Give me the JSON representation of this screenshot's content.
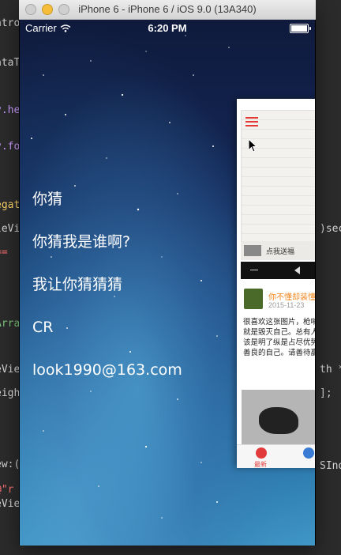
{
  "window": {
    "title": "iPhone 6 - iPhone 6 / iOS 9.0 (13A340)"
  },
  "status_bar": {
    "carrier": "Carrier",
    "time": "6:20 PM"
  },
  "menu": {
    "items": [
      {
        "label": "你猜"
      },
      {
        "label": "你猜我是谁啊?"
      },
      {
        "label": "我让你猜猜猜"
      },
      {
        "label": "CR"
      },
      {
        "label": "look1990@163.com"
      }
    ]
  },
  "preview": {
    "strip_text": "点我送福",
    "post_author": "你不懂却装懂",
    "post_date": "2015-11-23",
    "post_text": "很喜欢这张图片，枪哨声就是毁灭自己。总有人说该是明了纵是占尽优势做善良的自己。请善待赢了!",
    "tab_label": "最新"
  },
  "colors": {
    "accent_red": "#e53935",
    "author_orange": "#f0851c"
  }
}
